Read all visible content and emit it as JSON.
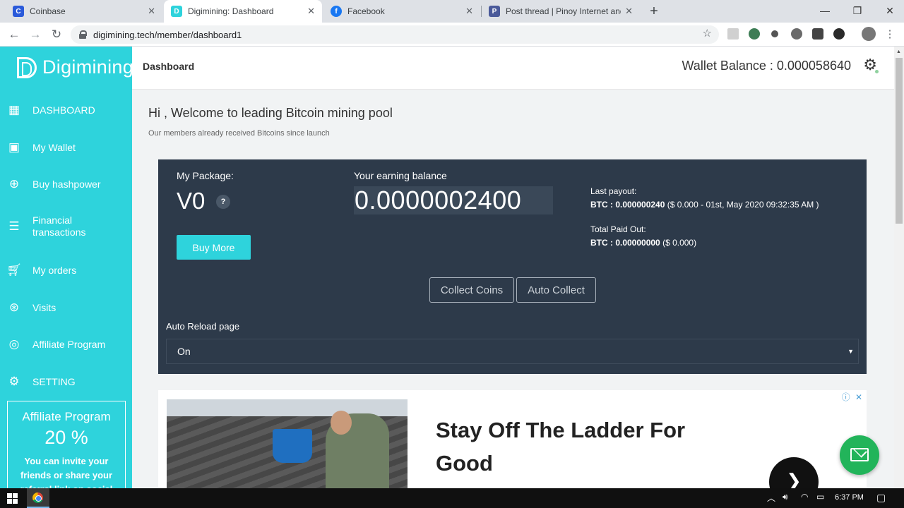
{
  "browser": {
    "tabs": [
      {
        "title": "Coinbase",
        "favicon": "coinbase-icon",
        "color": "#2a5ada"
      },
      {
        "title": "Digimining: Dashboard",
        "favicon": "digimining-icon",
        "color": "#2ed3dc"
      },
      {
        "title": "Facebook",
        "favicon": "facebook-icon",
        "color": "#1877f2"
      },
      {
        "title": "Post thread | Pinoy Internet and T",
        "favicon": "pinoy-icon",
        "color": "#4a5a9a"
      }
    ],
    "url": "digimining.tech/member/dashboard1"
  },
  "brand": {
    "name": "Digimining"
  },
  "sidebar": {
    "items": [
      {
        "label": "DASHBOARD",
        "icon": "dashboard-icon"
      },
      {
        "label": "My Wallet",
        "icon": "wallet-icon"
      },
      {
        "label": "Buy hashpower",
        "icon": "plus-circle-icon"
      },
      {
        "label": "Financial transactions",
        "icon": "list-icon"
      },
      {
        "label": "My orders",
        "icon": "cart-icon"
      },
      {
        "label": "Visits",
        "icon": "globe-icon"
      },
      {
        "label": "Affiliate Program",
        "icon": "broadcast-icon"
      },
      {
        "label": "SETTING",
        "icon": "gear-icon"
      }
    ],
    "affiliate_box": {
      "title": "Affiliate Program",
      "percent": "20 %",
      "text": "You can invite your friends or share your referral link on social"
    }
  },
  "header": {
    "breadcrumb": "Dashboard",
    "wallet_balance": "Wallet Balance : 0.000058640"
  },
  "main": {
    "welcome": "Hi , Welcome to leading Bitcoin mining pool",
    "subwelcome": "Our members already received Bitcoins since launch",
    "package_label": "My Package:",
    "package_value": "V0",
    "help_mark": "?",
    "buy_more": "Buy More",
    "earning_label": "Your earning balance",
    "earning_value": "0.0000002400",
    "last_payout_label": "Last payout:",
    "last_payout_btc": "BTC : 0.000000240",
    "last_payout_detail": " ($ 0.000 - 01st, May 2020 09:32:35 AM )",
    "total_paid_label": "Total Paid Out:",
    "total_paid_btc": "BTC : 0.00000000",
    "total_paid_detail": " ($ 0.000)",
    "collect_coins": "Collect Coins",
    "auto_collect": "Auto Collect",
    "auto_reload_label": "Auto Reload page",
    "auto_reload_value": "On"
  },
  "ad": {
    "headline": "Stay Off The Ladder For Good",
    "info": "ⓘ ✕"
  },
  "taskbar": {
    "time": "6:37 PM"
  },
  "colors": {
    "accent": "#2ed3dc",
    "panel": "#2d3a4a",
    "mail_button": "#22b45a"
  }
}
